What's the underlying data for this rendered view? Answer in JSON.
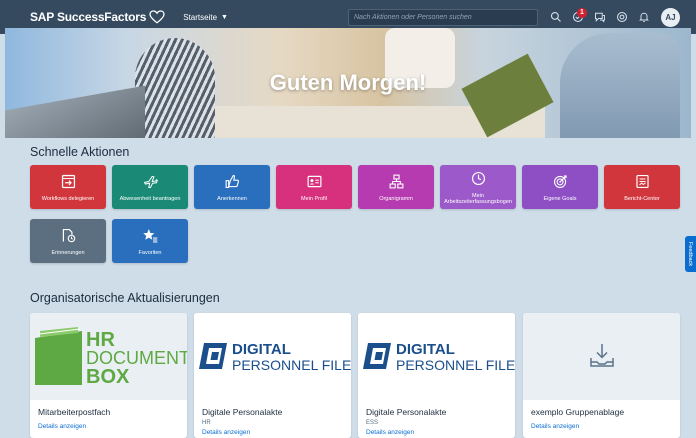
{
  "shell": {
    "brand": "SAP SuccessFactors",
    "nav_label": "Startseite",
    "search_placeholder": "Nach Aktionen oder Personen suchen",
    "notification_count": "1",
    "avatar_initials": "AJ"
  },
  "hero": {
    "greeting": "Guten Morgen!"
  },
  "quick_actions": {
    "title": "Schnelle Aktionen",
    "tiles": [
      {
        "label": "Workflows delegieren",
        "color": "#d1363d",
        "icon": "delegate-icon"
      },
      {
        "label": "Abwesenheit beantragen",
        "color": "#1a8a76",
        "icon": "airplane-icon"
      },
      {
        "label": "Anerkennen",
        "color": "#2a6fbd",
        "icon": "thumbs-up-icon"
      },
      {
        "label": "Mein Profil",
        "color": "#d7307d",
        "icon": "profile-card-icon"
      },
      {
        "label": "Organigramm",
        "color": "#b63bb0",
        "icon": "org-chart-icon"
      },
      {
        "label": "Mein Arbeitszeiterfassungsbogen",
        "color": "#9b59c9",
        "icon": "clock-icon"
      },
      {
        "label": "Eigene Goals",
        "color": "#8e4fc4",
        "icon": "target-icon"
      },
      {
        "label": "Bericht-Center",
        "color": "#d1363d",
        "icon": "report-icon"
      },
      {
        "label": "Erinnerungen",
        "color": "#5c6f80",
        "icon": "reminder-icon"
      },
      {
        "label": "Favoriten",
        "color": "#2a6fbd",
        "icon": "favorites-icon"
      }
    ]
  },
  "org_updates": {
    "title": "Organisatorische Aktualisierungen",
    "cards": [
      {
        "title": "Mitarbeiterpostfach",
        "subtitle": "",
        "link": "Details anzeigen",
        "logo": {
          "line1": "HR",
          "line2": "DOCUMENT",
          "line3": "BOX"
        }
      },
      {
        "title": "Digitale Personalakte",
        "subtitle": "HR",
        "link": "Details anzeigen",
        "logo": {
          "line1": "DIGITAL",
          "line2": "PERSONNEL FILE"
        }
      },
      {
        "title": "Digitale Personalakte",
        "subtitle": "ESS",
        "link": "Details anzeigen",
        "logo": {
          "line1": "DIGITAL",
          "line2": "PERSONNEL FILE"
        }
      },
      {
        "title": "exemplo Gruppenablage",
        "subtitle": "",
        "link": "Details anzeigen",
        "logo": {}
      }
    ]
  },
  "side_tab": {
    "label": "Feedback"
  },
  "colors": {
    "shell": "#354a5f",
    "link": "#0a6ed1",
    "hr_green": "#6ab84a",
    "dpf_blue": "#1b4f8c"
  }
}
